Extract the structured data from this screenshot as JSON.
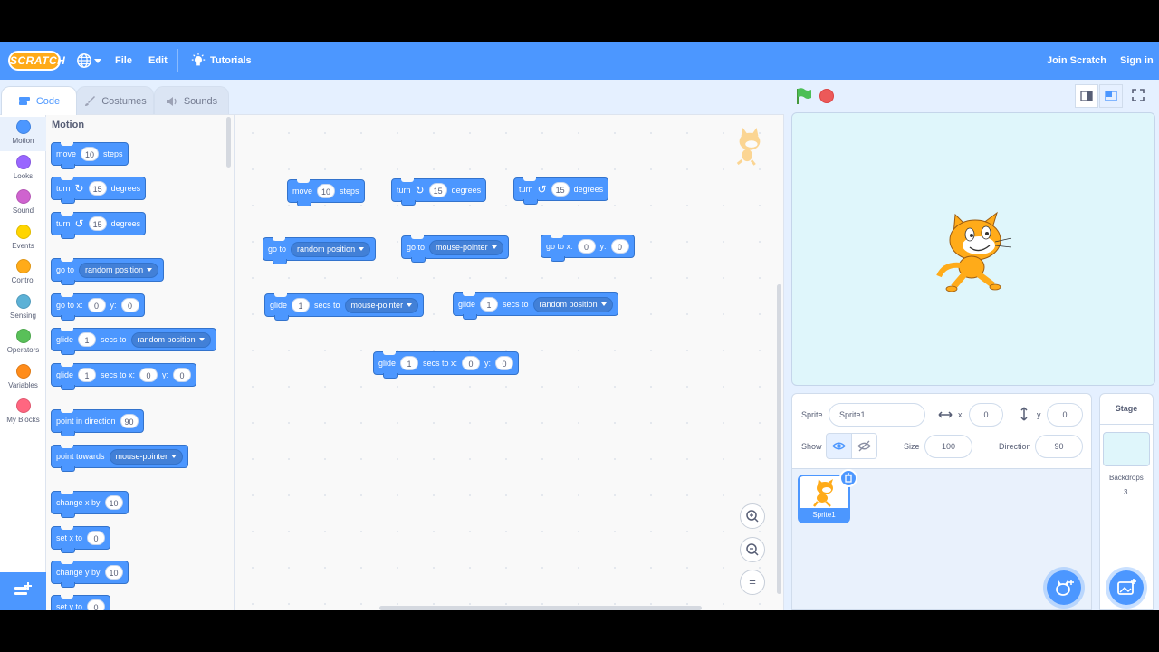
{
  "menubar": {
    "logo": "SCRATCH",
    "file": "File",
    "edit": "Edit",
    "tutorials": "Tutorials",
    "join": "Join Scratch",
    "signin": "Sign in"
  },
  "tabs": {
    "code": "Code",
    "costumes": "Costumes",
    "sounds": "Sounds"
  },
  "categories": [
    {
      "label": "Motion",
      "color": "#4c97ff"
    },
    {
      "label": "Looks",
      "color": "#9966ff"
    },
    {
      "label": "Sound",
      "color": "#cf63cf"
    },
    {
      "label": "Events",
      "color": "#ffd500"
    },
    {
      "label": "Control",
      "color": "#ffab19"
    },
    {
      "label": "Sensing",
      "color": "#5cb1d6"
    },
    {
      "label": "Operators",
      "color": "#59c059"
    },
    {
      "label": "Variables",
      "color": "#ff8c1a"
    },
    {
      "label": "My Blocks",
      "color": "#ff6680"
    }
  ],
  "palette": {
    "title": "Motion",
    "move": {
      "a": "move",
      "n": "10",
      "b": "steps"
    },
    "turn_cw": {
      "a": "turn",
      "n": "15",
      "b": "degrees"
    },
    "turn_ccw": {
      "a": "turn",
      "n": "15",
      "b": "degrees"
    },
    "goto": {
      "a": "go to",
      "d": "random position"
    },
    "gotoxy": {
      "a": "go to x:",
      "x": "0",
      "y_label": "y:",
      "y": "0"
    },
    "glide_to": {
      "a": "glide",
      "n": "1",
      "b": "secs to",
      "d": "random position"
    },
    "glide_xy": {
      "a": "glide",
      "n": "1",
      "b": "secs to x:",
      "x": "0",
      "y_label": "y:",
      "y": "0"
    },
    "point_dir": {
      "a": "point in direction",
      "n": "90"
    },
    "point_towards": {
      "a": "point towards",
      "d": "mouse-pointer"
    },
    "change_x": {
      "a": "change x by",
      "n": "10"
    },
    "set_x": {
      "a": "set x to",
      "n": "0"
    },
    "change_y": {
      "a": "change y by",
      "n": "10"
    },
    "set_y": {
      "a": "set y to",
      "n": "0"
    }
  },
  "workspace": {
    "move": {
      "a": "move",
      "n": "10",
      "b": "steps"
    },
    "turn_cw": {
      "a": "turn",
      "n": "15",
      "b": "degrees"
    },
    "turn_ccw": {
      "a": "turn",
      "n": "15",
      "b": "degrees"
    },
    "goto_random": {
      "a": "go to",
      "d": "random position"
    },
    "goto_mouse": {
      "a": "go to",
      "d": "mouse-pointer"
    },
    "gotoxy": {
      "a": "go to x:",
      "x": "0",
      "y_label": "y:",
      "y": "0"
    },
    "glide_mouse": {
      "a": "glide",
      "n": "1",
      "b": "secs to",
      "d": "mouse-pointer"
    },
    "glide_random": {
      "a": "glide",
      "n": "1",
      "b": "secs to",
      "d": "random position"
    },
    "glide_xy": {
      "a": "glide",
      "n": "1",
      "b": "secs to x:",
      "x": "0",
      "y_label": "y:",
      "y": "0"
    },
    "zoom_reset": "="
  },
  "sprite": {
    "label": "Sprite",
    "name": "Sprite1",
    "x_label": "x",
    "x": "0",
    "y_label": "y",
    "y": "0",
    "show_label": "Show",
    "size_label": "Size",
    "size": "100",
    "direction_label": "Direction",
    "direction": "90",
    "thumb_name": "Sprite1"
  },
  "stage_panel": {
    "title": "Stage",
    "backdrops_label": "Backdrops",
    "backdrops_count": "3"
  },
  "colors": {
    "menubar": "#4c97ff",
    "motion": "#4c97ff",
    "logo": "#ffab19"
  }
}
